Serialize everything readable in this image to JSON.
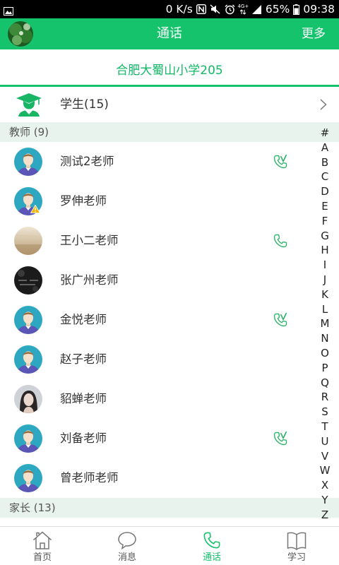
{
  "status_bar": {
    "net_speed": "0 K/s",
    "network_type": "4G+",
    "battery": "65%",
    "time": "09:38",
    "icons": [
      "image-icon",
      "nfc-icon",
      "mute-icon",
      "alarm-icon",
      "signal-icon",
      "battery-icon"
    ]
  },
  "header": {
    "title": "通话",
    "more": "更多",
    "avatar": "header-avatar"
  },
  "school": {
    "name": "合肥大蜀山小学205"
  },
  "students": {
    "label": "学生(15)",
    "icon": "graduate-icon"
  },
  "sections": [
    {
      "label": "教师 (9)",
      "members": [
        {
          "name": "测试2老师",
          "avatar": "default",
          "call_icon": "phone-v-icon"
        },
        {
          "name": "罗伸老师",
          "avatar": "default-warning"
        },
        {
          "name": "王小二老师",
          "avatar": "photo",
          "call_icon": "phone-icon"
        },
        {
          "name": "张广州老师",
          "avatar": "photo"
        },
        {
          "name": "金悦老师",
          "avatar": "default",
          "call_icon": "phone-v-icon"
        },
        {
          "name": "赵子老师",
          "avatar": "default"
        },
        {
          "name": "貂蝉老师",
          "avatar": "photo"
        },
        {
          "name": "刘备老师",
          "avatar": "default",
          "call_icon": "phone-v-icon"
        },
        {
          "name": "曾老师老师",
          "avatar": "default"
        }
      ]
    },
    {
      "label": "家长 (13)",
      "members": []
    }
  ],
  "index": [
    "#",
    "A",
    "B",
    "C",
    "D",
    "E",
    "F",
    "G",
    "H",
    "I",
    "J",
    "K",
    "L",
    "M",
    "N",
    "O",
    "P",
    "Q",
    "R",
    "S",
    "T",
    "U",
    "V",
    "W",
    "X",
    "Y",
    "Z"
  ],
  "tabs": [
    {
      "label": "首页",
      "icon": "home-icon",
      "active": false
    },
    {
      "label": "消息",
      "icon": "chat-icon",
      "active": false
    },
    {
      "label": "通话",
      "icon": "phone-icon",
      "active": true
    },
    {
      "label": "学习",
      "icon": "book-icon",
      "active": false
    }
  ],
  "colors": {
    "primary": "#16c36d",
    "primary_text": "#12b866",
    "section_bg": "#e8f3ed",
    "status_bar": "#000000"
  }
}
